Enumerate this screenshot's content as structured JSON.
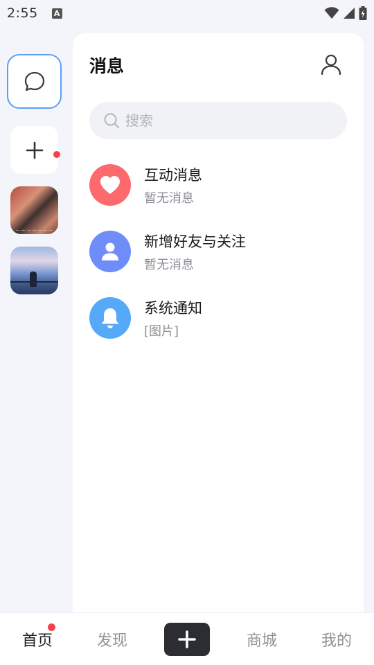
{
  "status_bar": {
    "time": "2:55",
    "notification_icon": "a-icon"
  },
  "rail": {
    "chat_icon": "chat-bubble-icon",
    "add_icon": "plus-icon",
    "avatars": [
      {
        "name": "group-avatar-1",
        "has_unread": true
      },
      {
        "name": "group-avatar-2",
        "has_unread": false
      }
    ]
  },
  "header": {
    "title": "消息",
    "profile_icon": "person-icon"
  },
  "search": {
    "placeholder": "搜索"
  },
  "messages": [
    {
      "title": "互动消息",
      "subtitle": "暂无消息",
      "icon": "heart-icon",
      "color": "#fd6a6e"
    },
    {
      "title": "新增好友与关注",
      "subtitle": "暂无消息",
      "icon": "person-icon",
      "color": "#6f8df9"
    },
    {
      "title": "系统通知",
      "subtitle": "[图片]",
      "icon": "bell-icon",
      "color": "#56a9f8"
    }
  ],
  "bottom_nav": {
    "tabs": [
      {
        "label": "首页",
        "active": true,
        "has_dot": true
      },
      {
        "label": "发现",
        "active": false
      },
      {
        "label": "商城",
        "active": false
      },
      {
        "label": "我的",
        "active": false
      }
    ],
    "add_icon": "plus-icon"
  },
  "colors": {
    "accent_border": "#5b9ff5",
    "unread_dot": "#f5414d",
    "add_button_bg": "#2b2d32"
  }
}
